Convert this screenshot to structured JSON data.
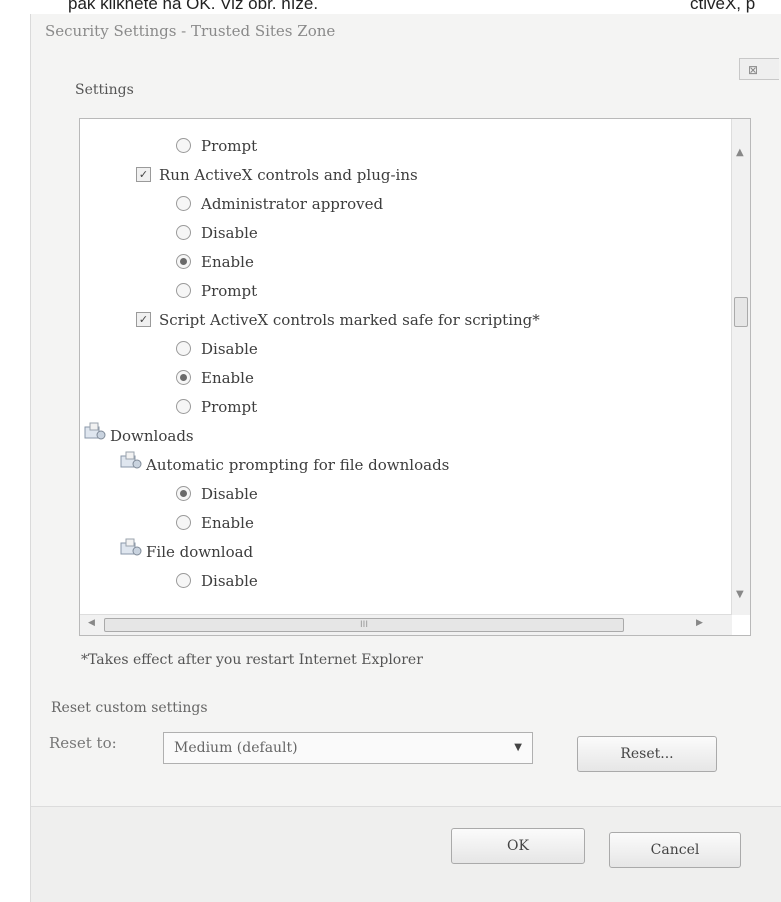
{
  "caption": {
    "left": "pak klikněte na OK. Viz obr. níže.",
    "right": "ctiveX, p"
  },
  "dialog": {
    "title": "Security Settings - Trusted Sites Zone",
    "close_glyph": "⊠",
    "settings_label": "Settings",
    "footnote": "*Takes effect after you restart Internet Explorer",
    "reset_section_label": "Reset custom settings",
    "reset_to_label": "Reset to:",
    "reset_select_value": "Medium (default)",
    "reset_button": "Reset...",
    "ok_button": "OK",
    "cancel_button": "Cancel"
  },
  "tree": [
    {
      "kind": "radio",
      "label": "Prompt",
      "checked": false
    },
    {
      "kind": "check",
      "label": "Run ActiveX controls and plug-ins"
    },
    {
      "kind": "radio",
      "label": "Administrator approved",
      "checked": false
    },
    {
      "kind": "radio",
      "label": "Disable",
      "checked": false
    },
    {
      "kind": "radio",
      "label": "Enable",
      "checked": true
    },
    {
      "kind": "radio",
      "label": "Prompt",
      "checked": false
    },
    {
      "kind": "check",
      "label": "Script ActiveX controls marked safe for scripting*"
    },
    {
      "kind": "radio",
      "label": "Disable",
      "checked": false
    },
    {
      "kind": "radio",
      "label": "Enable",
      "checked": true
    },
    {
      "kind": "radio",
      "label": "Prompt",
      "checked": false
    },
    {
      "kind": "category",
      "label": "Downloads"
    },
    {
      "kind": "subcategory",
      "label": "Automatic prompting for file downloads"
    },
    {
      "kind": "radio",
      "label": "Disable",
      "checked": true
    },
    {
      "kind": "radio",
      "label": "Enable",
      "checked": false
    },
    {
      "kind": "subcategory",
      "label": "File download"
    },
    {
      "kind": "radio",
      "label": "Disable",
      "checked": false
    }
  ],
  "hscroll_grip": "III"
}
